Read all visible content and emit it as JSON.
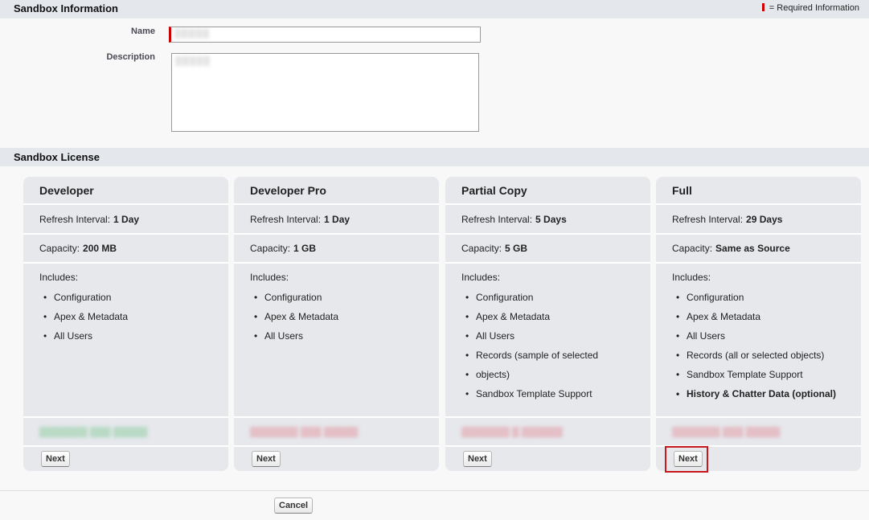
{
  "sandbox_info": {
    "title": "Sandbox Information",
    "required_note": "= Required Information",
    "name_label": "Name",
    "name_value": "▒▒▒▒▒",
    "description_label": "Description",
    "description_value": "▒▒▒▒▒"
  },
  "license": {
    "title": "Sandbox License",
    "refresh_label": "Refresh Interval:",
    "capacity_label": "Capacity:",
    "includes_label": "Includes:",
    "cards": [
      {
        "name": "Developer",
        "refresh": "1 Day",
        "capacity": "200 MB",
        "includes": [
          "Configuration",
          "Apex & Metadata",
          "All Users"
        ],
        "status": "▒▒▒▒▒▒▒ ▒▒▒ ▒▒▒▒▒",
        "next_label": "Next"
      },
      {
        "name": "Developer Pro",
        "refresh": "1 Day",
        "capacity": "1 GB",
        "includes": [
          "Configuration",
          "Apex & Metadata",
          "All Users"
        ],
        "status": "▒▒▒▒▒▒▒ ▒▒▒ ▒▒▒▒▒",
        "next_label": "Next"
      },
      {
        "name": "Partial Copy",
        "refresh": "5 Days",
        "capacity": "5 GB",
        "includes": [
          "Configuration",
          "Apex & Metadata",
          "All Users",
          "Records (sample of selected",
          "objects)",
          "Sandbox Template Support"
        ],
        "status": "▒▒▒▒▒▒▒ ▒ ▒▒▒▒▒▒",
        "next_label": "Next"
      },
      {
        "name": "Full",
        "refresh": "29 Days",
        "capacity": "Same as Source",
        "includes": [
          "Configuration",
          "Apex & Metadata",
          "All Users",
          "Records (all or selected objects)",
          "Sandbox Template Support"
        ],
        "includes_bold": "History & Chatter Data (optional)",
        "status": "▒▒▒▒▒▒▒ ▒▒▒ ▒▒▒▒▒",
        "next_label": "Next"
      }
    ]
  },
  "footer": {
    "cancel_label": "Cancel"
  },
  "colors": {
    "accent_red": "#c00",
    "header_bg": "#e4e7ec",
    "card_bg": "#e6e8ec"
  }
}
